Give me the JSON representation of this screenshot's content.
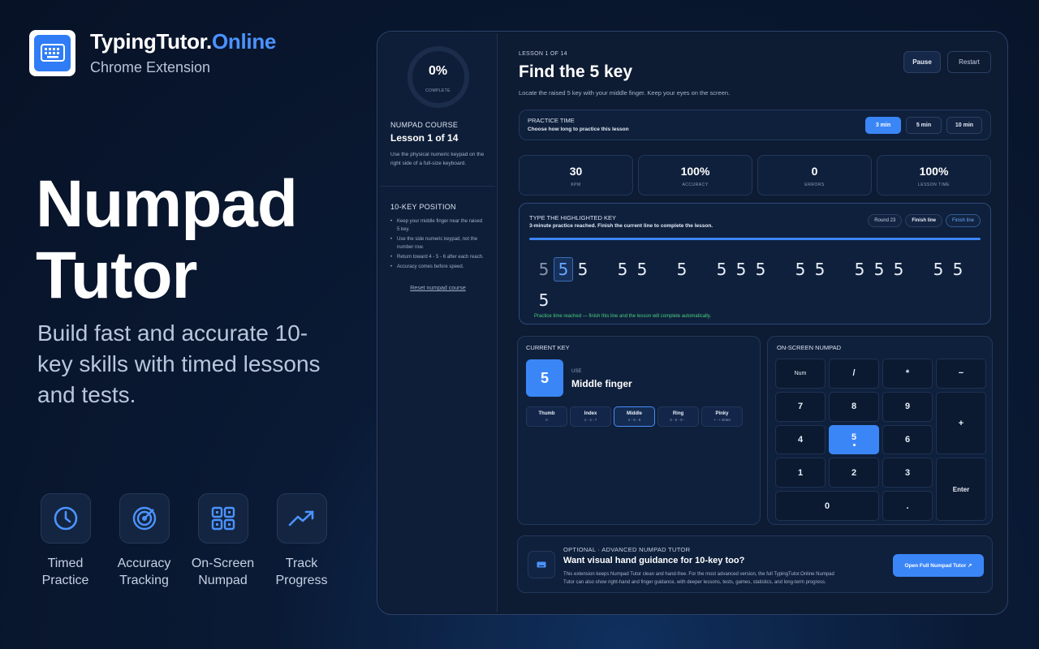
{
  "brand": {
    "name_main": "TypingTutor.",
    "name_accent": "Online",
    "subtitle": "Chrome Extension"
  },
  "hero": {
    "title_line1": "Numpad",
    "title_line2": "Tutor",
    "subtitle": "Build fast and accurate 10-key skills with timed lessons and tests."
  },
  "features": [
    {
      "icon": "clock-icon",
      "label": "Timed Practice"
    },
    {
      "icon": "target-icon",
      "label": "Accuracy Tracking"
    },
    {
      "icon": "numpad-icon",
      "label": "On-Screen Numpad"
    },
    {
      "icon": "trend-up-icon",
      "label": "Track Progress"
    }
  ],
  "sidebar": {
    "progress_value": "0%",
    "progress_caption": "COMPLETE",
    "course_label": "NUMPAD COURSE",
    "course_lesson": "Lesson 1 of 14",
    "course_text": "Use the physical numeric keypad on the right side of a full-size keyboard.",
    "position_label": "10-KEY POSITION",
    "position_tips": [
      "Keep your middle finger near the raised 5 key.",
      "Use the side numeric keypad, not the number row.",
      "Return toward 4 - 5 - 6 after each reach.",
      "Accuracy comes before speed."
    ],
    "reset_link": "Reset numpad course"
  },
  "lesson": {
    "tag": "LESSON 1 OF 14",
    "title": "Find the 5 key",
    "description": "Locate the raised 5 key with your middle finger. Keep your eyes on the screen.",
    "pause_label": "Pause",
    "restart_label": "Restart"
  },
  "practice": {
    "label": "PRACTICE TIME",
    "hint": "Choose how long to practice this lesson",
    "options": [
      "3 min",
      "5 min",
      "10 min"
    ],
    "selected": "3 min"
  },
  "stats": [
    {
      "value": "30",
      "label": "KPM"
    },
    {
      "value": "100%",
      "label": "ACCURACY"
    },
    {
      "value": "0",
      "label": "ERRORS"
    },
    {
      "value": "100%",
      "label": "LESSON TIME"
    }
  ],
  "typing": {
    "label": "TYPE THE HIGHLIGHTED KEY",
    "status": "3-minute practice reached. Finish the current line to complete the lesson.",
    "round": "Round 23",
    "finish_line_1": "Finish line",
    "finish_line_2": "Finish line",
    "progress_percent": 100,
    "note": "Practice time reached — finish this line and the lesson will complete automatically.",
    "digits": [
      "5",
      "5",
      "5",
      " ",
      "5",
      "5",
      " ",
      "5",
      " ",
      "5",
      "5",
      "5",
      " ",
      "5",
      "5",
      " ",
      "5",
      "5",
      "5",
      " ",
      "5",
      "5",
      "5"
    ],
    "cursor_index": 1,
    "completed_count": 1
  },
  "current_key": {
    "label": "CURRENT KEY",
    "key": "5",
    "use_label": "USE",
    "finger": "Middle finger",
    "fingers": [
      {
        "name": "Thumb",
        "keys": "0",
        "active": false
      },
      {
        "name": "Index",
        "keys": "1 - 4 - 7",
        "active": false
      },
      {
        "name": "Middle",
        "keys": "2 - 5 - 8",
        "active": true
      },
      {
        "name": "Ring",
        "keys": "3 - 6 - 9 - .",
        "active": false
      },
      {
        "name": "Pinky",
        "keys": "+ - + Enter",
        "active": false
      }
    ]
  },
  "numpad": {
    "label": "ON-SCREEN NUMPAD",
    "keys": {
      "num": "Num",
      "slash": "/",
      "star": "*",
      "minus": "−",
      "k7": "7",
      "k8": "8",
      "k9": "9",
      "plus": "+",
      "k4": "4",
      "k5": "5",
      "k6": "6",
      "k1": "1",
      "k2": "2",
      "k3": "3",
      "enter": "Enter",
      "k0": "0",
      "dot": "."
    },
    "highlighted": "5"
  },
  "promo": {
    "tag": "OPTIONAL · ADVANCED NUMPAD TUTOR",
    "title": "Want visual hand guidance for 10-key too?",
    "text": "This extension keeps Numpad Tutor clean and hand-free. For the most advanced version, the full TypingTutor.Online Numpad Tutor can also show right-hand and finger guidance, with deeper lessons, tests, games, statistics, and long-term progress.",
    "cta": "Open Full Numpad Tutor ↗"
  },
  "colors": {
    "accent": "#3b86f7",
    "brand_accent": "#4b93ff",
    "success": "#4ad07e",
    "background": "#0a1a35"
  }
}
